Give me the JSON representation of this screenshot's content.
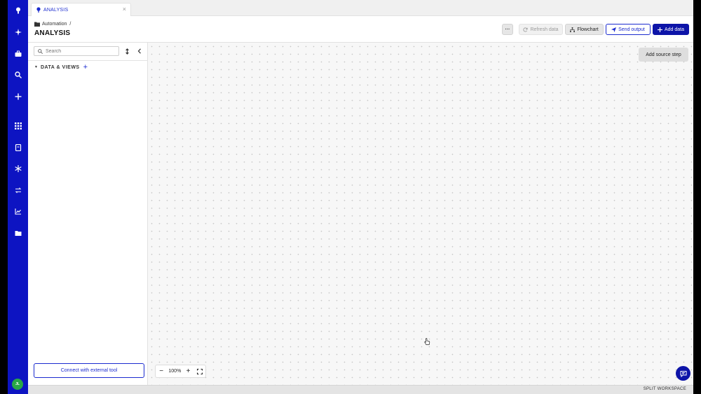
{
  "tab": {
    "label": "ANALYSIS",
    "icon": "pin-icon"
  },
  "header": {
    "breadcrumb": "Automation",
    "breadcrumb_separator": "/",
    "title": "ANALYSIS",
    "more_label": "···",
    "refresh_label": "Refresh data",
    "flowchart_label": "Flowchart",
    "send_output_label": "Send output",
    "add_data_label": "Add data"
  },
  "sidebar": {
    "search_placeholder": "Search",
    "section_label": "DATA & VIEWS",
    "connect_label": "Connect with external tool"
  },
  "canvas": {
    "add_source_label": "Add source step",
    "zoom_level": "100%"
  },
  "user": {
    "initials": "JL"
  },
  "statusbar": {
    "text": "SPLIT WORKSPACE"
  },
  "colors": {
    "accent": "#1b2bcf",
    "rail": "#0d14c2",
    "primary_button": "#0d14a8",
    "avatar": "#28a745"
  }
}
